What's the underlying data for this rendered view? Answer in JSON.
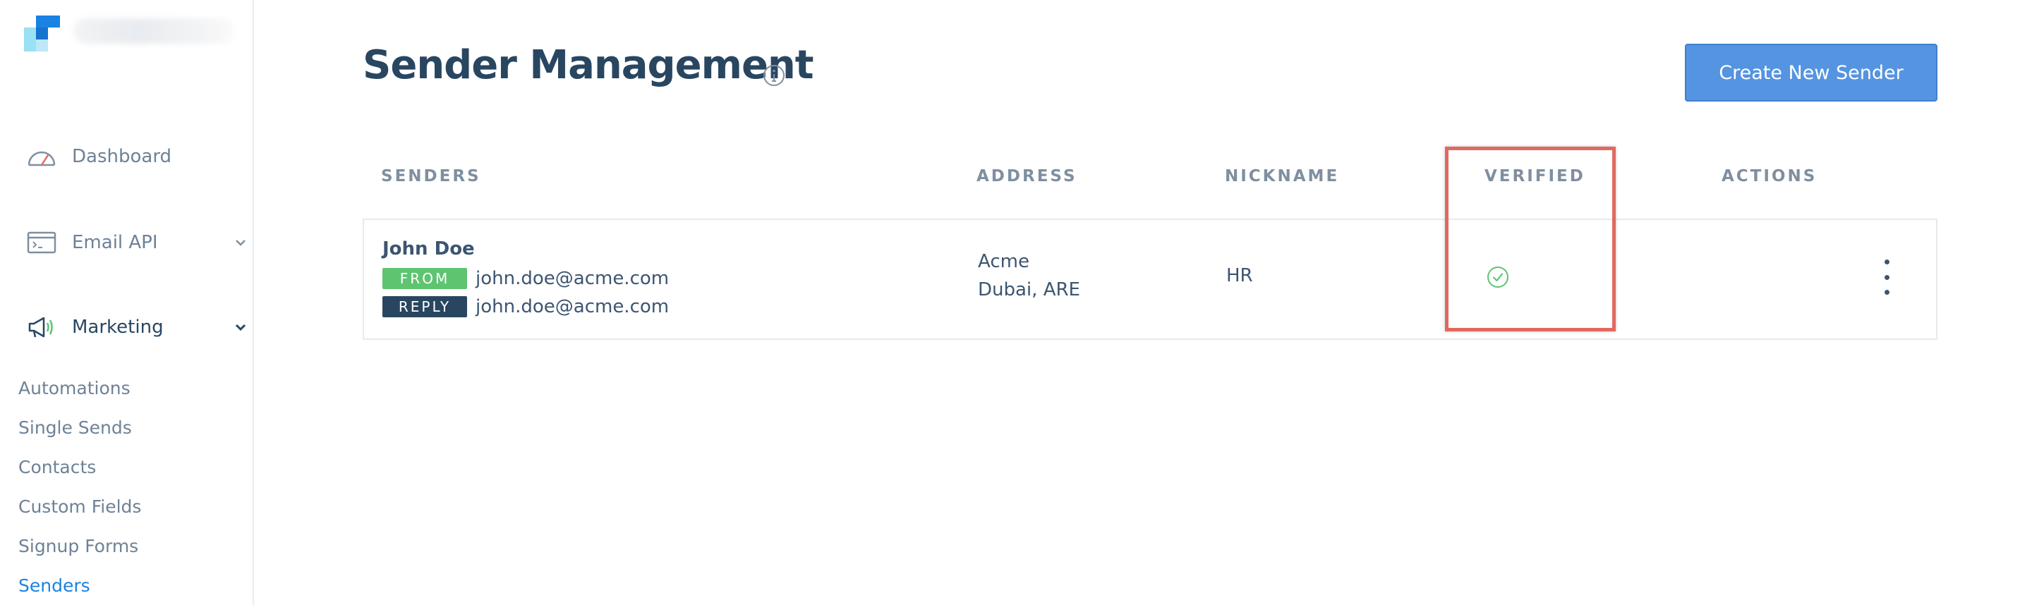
{
  "sidebar": {
    "account_name": "",
    "nav": [
      {
        "label": "Dashboard",
        "icon": "gauge-icon"
      },
      {
        "label": "Email API",
        "icon": "terminal-card-icon",
        "expanded": false
      },
      {
        "label": "Marketing",
        "icon": "megaphone-icon",
        "expanded": true
      }
    ],
    "marketing_items": [
      {
        "label": "Automations"
      },
      {
        "label": "Single Sends"
      },
      {
        "label": "Contacts"
      },
      {
        "label": "Custom Fields"
      },
      {
        "label": "Signup Forms"
      },
      {
        "label": "Senders",
        "active": true
      }
    ]
  },
  "header": {
    "title": "Sender Management",
    "create_button": "Create New Sender"
  },
  "table": {
    "columns": [
      "SENDERS",
      "ADDRESS",
      "NICKNAME",
      "VERIFIED",
      "ACTIONS"
    ],
    "rows": [
      {
        "name": "John Doe",
        "from_tag": "FROM",
        "from_email": "john.doe@acme.com",
        "reply_tag": "REPLY",
        "reply_email": "john.doe@acme.com",
        "address_line1": "Acme",
        "address_line2": "Dubai, ARE",
        "nickname": "HR",
        "verified": true
      }
    ]
  },
  "colors": {
    "accent": "#1a82e2",
    "button": "#5594e0",
    "from_tag": "#5ec470",
    "reply_tag": "#294661",
    "verified": "#5ec470",
    "highlight": "#e06a60"
  }
}
